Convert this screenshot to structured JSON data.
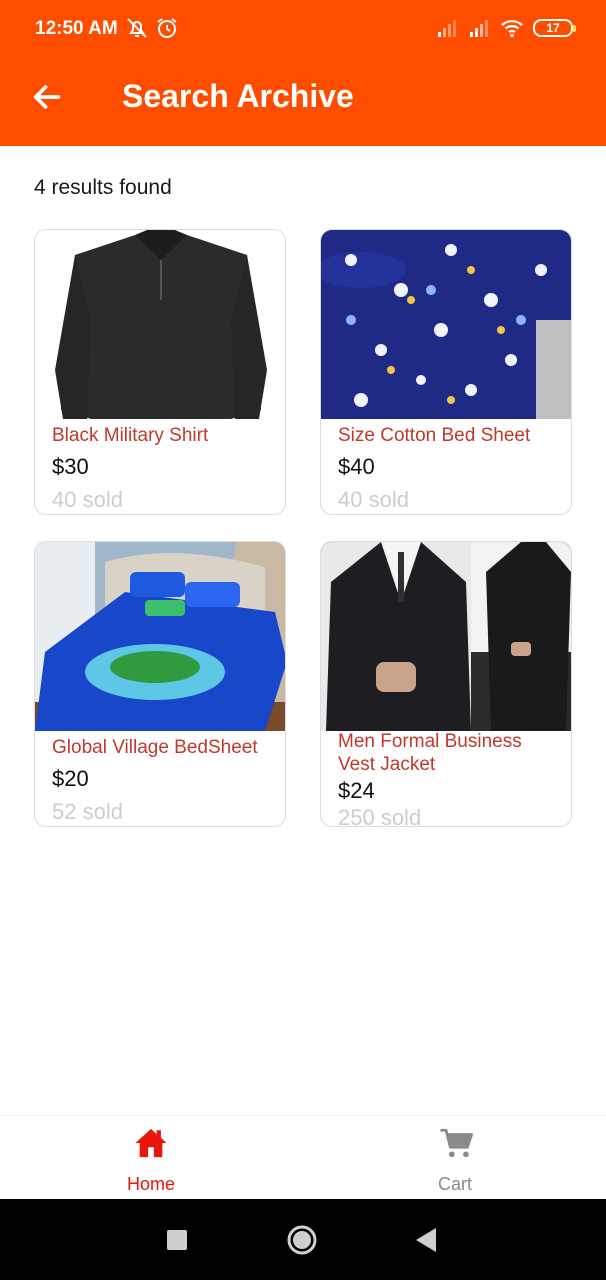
{
  "status_bar": {
    "time": "12:50 AM",
    "battery": "17",
    "icons": [
      "mute-icon",
      "alarm-icon",
      "signal-icon",
      "signal-icon",
      "wifi-icon",
      "battery-icon"
    ]
  },
  "app_bar": {
    "title": "Search Archive",
    "back_icon": "arrow-left-icon"
  },
  "results_text": "4 results found",
  "products": [
    {
      "name_lines": [
        "Black Military Shirt"
      ],
      "price": "$30",
      "sold": "40 sold",
      "image": "black-shirt-image"
    },
    {
      "name_lines": [
        "Size Cotton Bed Sheet"
      ],
      "price": "$40",
      "sold": "40 sold",
      "image": "floral-bed-sheet-image"
    },
    {
      "name_lines": [
        "Global Village BedSheet"
      ],
      "price": "$20",
      "sold": "52 sold",
      "image": "island-bed-sheet-image"
    },
    {
      "name_lines": [
        "Men Formal Business",
        "Vest Jacket"
      ],
      "price": "$24",
      "sold": "250 sold",
      "image": "formal-suit-image"
    }
  ],
  "bottom_nav": {
    "home_label": "Home",
    "cart_label": "Cart",
    "active_color": "#e8170c",
    "inactive_color": "#8a8a8a"
  },
  "colors": {
    "brand": "#ff4d00",
    "product_name": "#c0392b",
    "sold": "#c9cdd3"
  }
}
